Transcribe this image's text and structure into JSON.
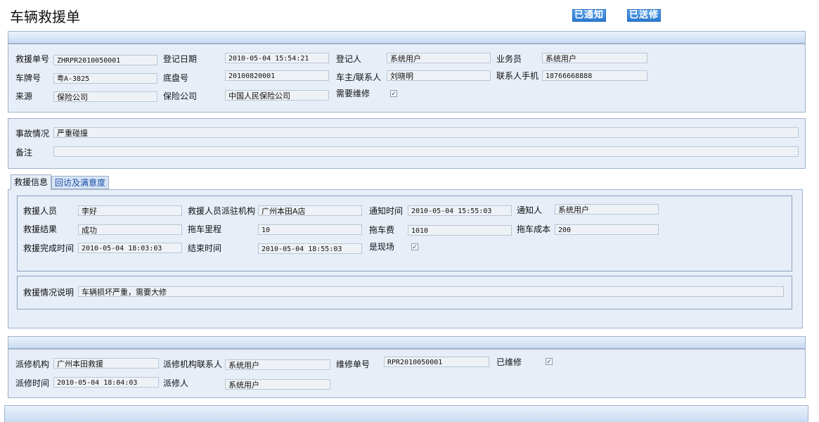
{
  "title": "车辆救援单",
  "buttons": {
    "notified": "已通知",
    "sent_repair": "已送修"
  },
  "basic": {
    "rescue_no_label": "救援单号",
    "rescue_no": "ZHRPR2010050001",
    "reg_date_label": "登记日期",
    "reg_date": "2010-05-04 15:54:21",
    "registrar_label": "登记人",
    "registrar": "系统用户",
    "salesman_label": "业务员",
    "salesman": "系统用户",
    "plate_label": "车牌号",
    "plate": "粤A-3825",
    "chassis_label": "底盘号",
    "chassis": "20100820001",
    "owner_label": "车主/联系人",
    "owner": "刘晓明",
    "phone_label": "联系人手机",
    "phone": "18766668888",
    "source_label": "来源",
    "source": "保险公司",
    "insurer_label": "保险公司",
    "insurer": "中国人民保险公司",
    "need_repair_label": "需要维修",
    "need_repair": true
  },
  "accident": {
    "situation_label": "事故情况",
    "situation": "严重碰撞",
    "remark_label": "备注",
    "remark": ""
  },
  "tabs": [
    "救援信息",
    "回访及满意度"
  ],
  "rescue": {
    "staff_label": "救援人员",
    "staff": "李好",
    "org_label": "救援人员派驻机构",
    "org": "广州本田A店",
    "notify_time_label": "通知时间",
    "notify_time": "2010-05-04 15:55:03",
    "notifier_label": "通知人",
    "notifier": "系统用户",
    "result_label": "救援结果",
    "result": "成功",
    "tow_distance_label": "拖车里程",
    "tow_distance": "10",
    "tow_fee_label": "拖车费",
    "tow_fee": "1010",
    "tow_cost_label": "拖车成本",
    "tow_cost": "200",
    "finish_time_label": "救援完成时间",
    "finish_time": "2010-05-04 18:03:03",
    "end_time_label": "结束时间",
    "end_time": "2010-05-04 18:55:03",
    "on_site_label": "是现场",
    "on_site": true,
    "desc_label": "救援情况说明",
    "desc": "车辆损坏严重，需要大修"
  },
  "dispatch": {
    "org_label": "派修机构",
    "org": "广州本田救援",
    "contact_label": "派修机构联系人",
    "contact": "系统用户",
    "repair_no_label": "维修单号",
    "repair_no": "RPR2010050001",
    "repaired_label": "已维修",
    "repaired": true,
    "time_label": "派修时间",
    "time": "2010-05-04 18:04:03",
    "person_label": "派修人",
    "person": "系统用户"
  }
}
